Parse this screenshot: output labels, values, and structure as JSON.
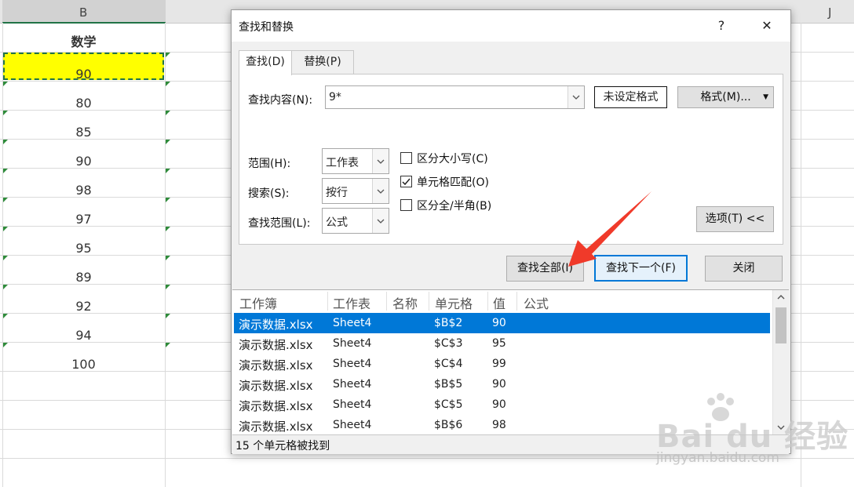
{
  "sheet": {
    "col_b": "B",
    "col_j": "J",
    "header_cell": "数学",
    "values": [
      "90",
      "80",
      "85",
      "90",
      "98",
      "97",
      "95",
      "89",
      "92",
      "94",
      "100"
    ]
  },
  "dialog": {
    "title": "查找和替换",
    "help": "?",
    "close": "✕",
    "tabs": [
      "查找(D)",
      "替换(P)"
    ],
    "find_label": "查找内容(N):",
    "find_value": "9*",
    "no_format": "未设定格式",
    "format_btn": "格式(M)...",
    "scope_label": "范围(H):",
    "scope_value": "工作表",
    "search_label": "搜索(S):",
    "search_value": "按行",
    "lookin_label": "查找范围(L):",
    "lookin_value": "公式",
    "match_case": "区分大小写(C)",
    "match_cell": "单元格匹配(O)",
    "match_width": "区分全/半角(B)",
    "options_btn": "选项(T) <<",
    "find_all_btn": "查找全部(I)",
    "find_next_btn": "查找下一个(F)",
    "close_btn": "关闭"
  },
  "results": {
    "headers": [
      "工作簿",
      "工作表",
      "名称",
      "单元格",
      "值",
      "公式"
    ],
    "rows": [
      {
        "book": "演示数据.xlsx",
        "sheet": "Sheet4",
        "cell": "$B$2",
        "value": "90"
      },
      {
        "book": "演示数据.xlsx",
        "sheet": "Sheet4",
        "cell": "$C$3",
        "value": "95"
      },
      {
        "book": "演示数据.xlsx",
        "sheet": "Sheet4",
        "cell": "$C$4",
        "value": "99"
      },
      {
        "book": "演示数据.xlsx",
        "sheet": "Sheet4",
        "cell": "$B$5",
        "value": "90"
      },
      {
        "book": "演示数据.xlsx",
        "sheet": "Sheet4",
        "cell": "$C$5",
        "value": "90"
      },
      {
        "book": "演示数据.xlsx",
        "sheet": "Sheet4",
        "cell": "$B$6",
        "value": "98"
      }
    ],
    "status": "15 个单元格被找到"
  },
  "watermark": {
    "brand": "Bai  du 经验",
    "url": "jingyan.baidu.com"
  },
  "colors": {
    "selection": "#0078d7",
    "highlight_cell": "#ffff00",
    "arrow": "#f03a2a"
  }
}
